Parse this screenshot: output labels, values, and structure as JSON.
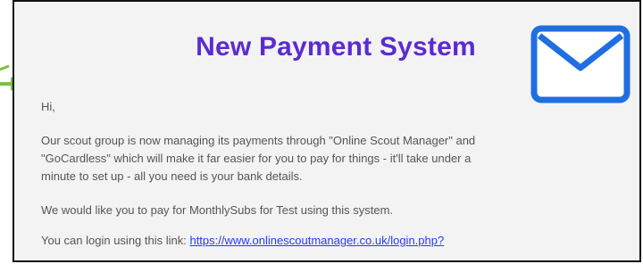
{
  "email": {
    "title": "New Payment System",
    "greeting": "Hi,",
    "paragraph1_line1": "Our scout group is now managing its payments through \"Online Scout Manager\" and",
    "paragraph1_line2": "\"GoCardless\" which will make it far easier for you to pay for things - it'll take under a",
    "paragraph1_line3": "minute to set up - all you need is your bank details.",
    "pay_line": "We would like you to pay for MonthlySubs for Test using this system.",
    "login_prefix": "You can login using this link: ",
    "login_link": "https://www.onlinescoutmanager.co.uk/login.php?"
  },
  "icons": {
    "mail": "envelope-icon",
    "arrow": "arrow-right-icon"
  },
  "colors": {
    "title": "#5b2bd0",
    "link": "#1e3fff",
    "envelope": "#1f6fe3",
    "arrow": "#7bc142"
  }
}
